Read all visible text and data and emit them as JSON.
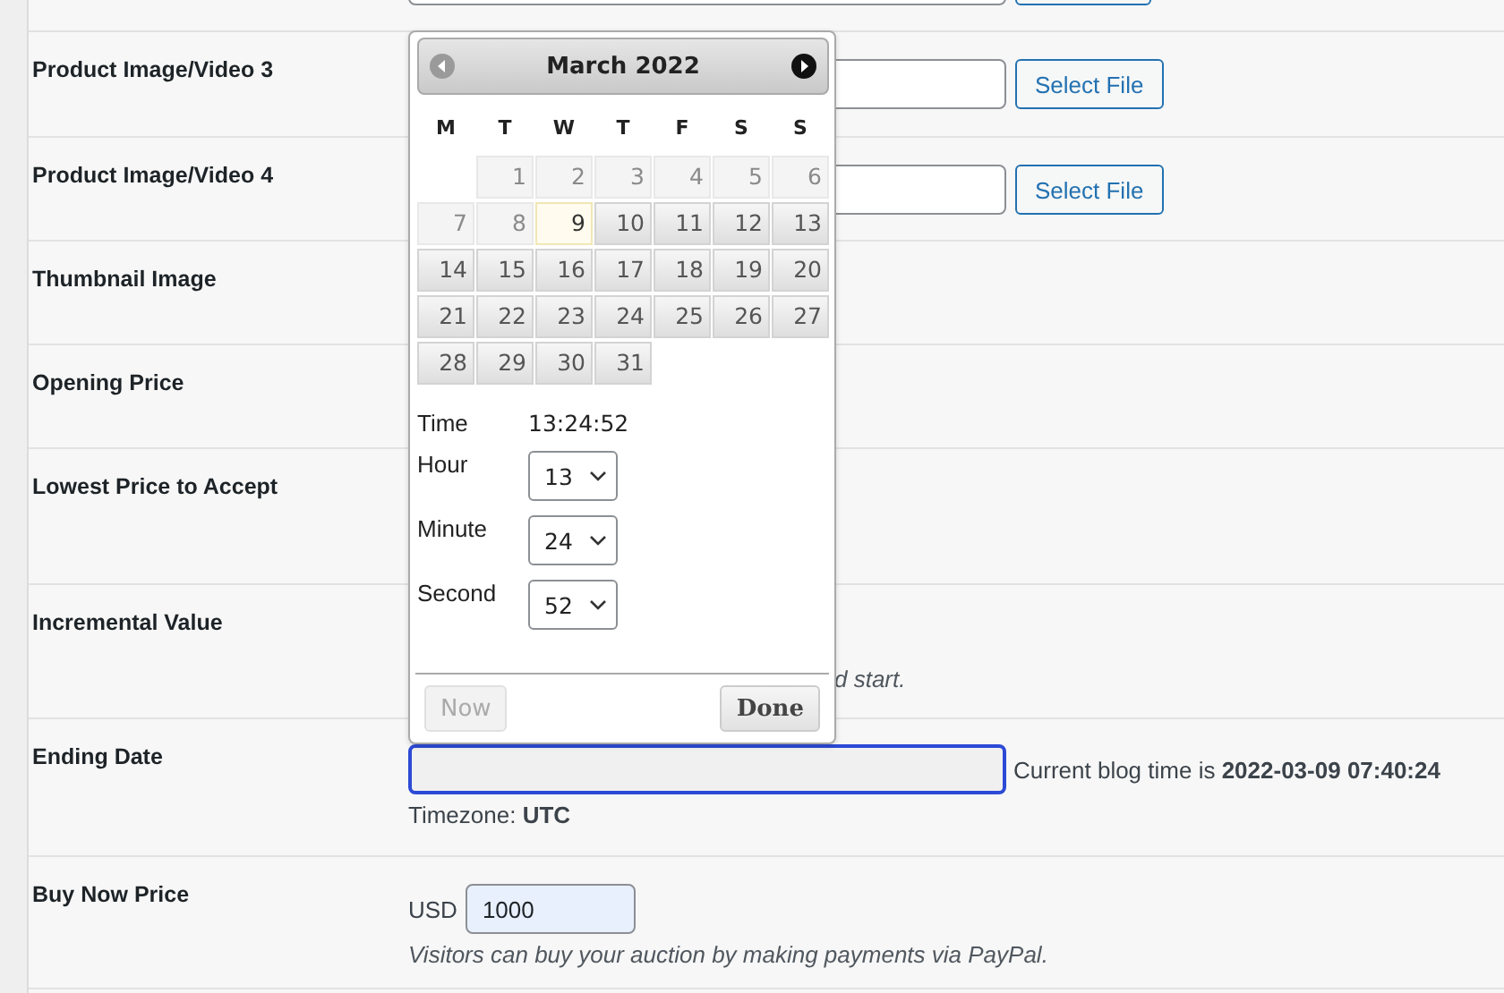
{
  "form_rows": [
    {
      "kind": "file"
    },
    {
      "label": "Product Image/Video 3",
      "kind": "file",
      "button": "Select File"
    },
    {
      "label": "Product Image/Video 4",
      "kind": "file",
      "button": "Select File"
    },
    {
      "label": "Thumbnail Image",
      "kind": "hidden"
    },
    {
      "label": "Opening Price",
      "kind": "hidden"
    },
    {
      "label": "Lowest Price to Accept",
      "kind": "hidden"
    },
    {
      "label": "Incremental Value",
      "kind": "note",
      "note": "d start."
    },
    {
      "label": "Ending Date",
      "kind": "date",
      "focused": true,
      "blog_time": "Current blog time is **2022-03-09 07:40:24**",
      "timezone": "Timezone: **UTC**"
    },
    {
      "label": "Buy Now Price",
      "kind": "price",
      "currency": "USD",
      "value": "1000",
      "note": "Visitors can buy your auction by making payments via PayPal."
    }
  ],
  "datepicker": {
    "title": "March 2022",
    "prev": {
      "disabled": true
    },
    "next": {
      "disabled": false
    },
    "weekdays": [
      "M",
      "T",
      "W",
      "T",
      "F",
      "S",
      "S"
    ],
    "days": [
      {
        "kind": "blank"
      },
      {
        "label": "1",
        "kind": "disabled"
      },
      {
        "label": "2",
        "kind": "disabled"
      },
      {
        "label": "3",
        "kind": "disabled"
      },
      {
        "label": "4",
        "kind": "disabled"
      },
      {
        "label": "5",
        "kind": "disabled"
      },
      {
        "label": "6",
        "kind": "disabled"
      },
      {
        "label": "7",
        "kind": "disabled"
      },
      {
        "label": "8",
        "kind": "disabled"
      },
      {
        "label": "9",
        "kind": "today"
      },
      {
        "label": "10",
        "kind": "day"
      },
      {
        "label": "11",
        "kind": "day"
      },
      {
        "label": "12",
        "kind": "day"
      },
      {
        "label": "13",
        "kind": "day"
      },
      {
        "label": "14",
        "kind": "day"
      },
      {
        "label": "15",
        "kind": "day"
      },
      {
        "label": "16",
        "kind": "day"
      },
      {
        "label": "17",
        "kind": "day"
      },
      {
        "label": "18",
        "kind": "day"
      },
      {
        "label": "19",
        "kind": "day"
      },
      {
        "label": "20",
        "kind": "day"
      },
      {
        "label": "21",
        "kind": "day"
      },
      {
        "label": "22",
        "kind": "day"
      },
      {
        "label": "23",
        "kind": "day"
      },
      {
        "label": "24",
        "kind": "day"
      },
      {
        "label": "25",
        "kind": "day"
      },
      {
        "label": "26",
        "kind": "day"
      },
      {
        "label": "27",
        "kind": "day"
      },
      {
        "label": "28",
        "kind": "day"
      },
      {
        "label": "29",
        "kind": "day"
      },
      {
        "label": "30",
        "kind": "day"
      },
      {
        "label": "31",
        "kind": "day"
      }
    ],
    "time_label": "Time",
    "time": "13:24:52",
    "selects": [
      {
        "label": "Hour",
        "value": "13"
      },
      {
        "label": "Minute",
        "value": "24"
      },
      {
        "label": "Second",
        "value": "52"
      }
    ],
    "now_button": {
      "label": "Now",
      "disabled": true
    },
    "done_button": {
      "label": "Done",
      "disabled": false
    }
  }
}
